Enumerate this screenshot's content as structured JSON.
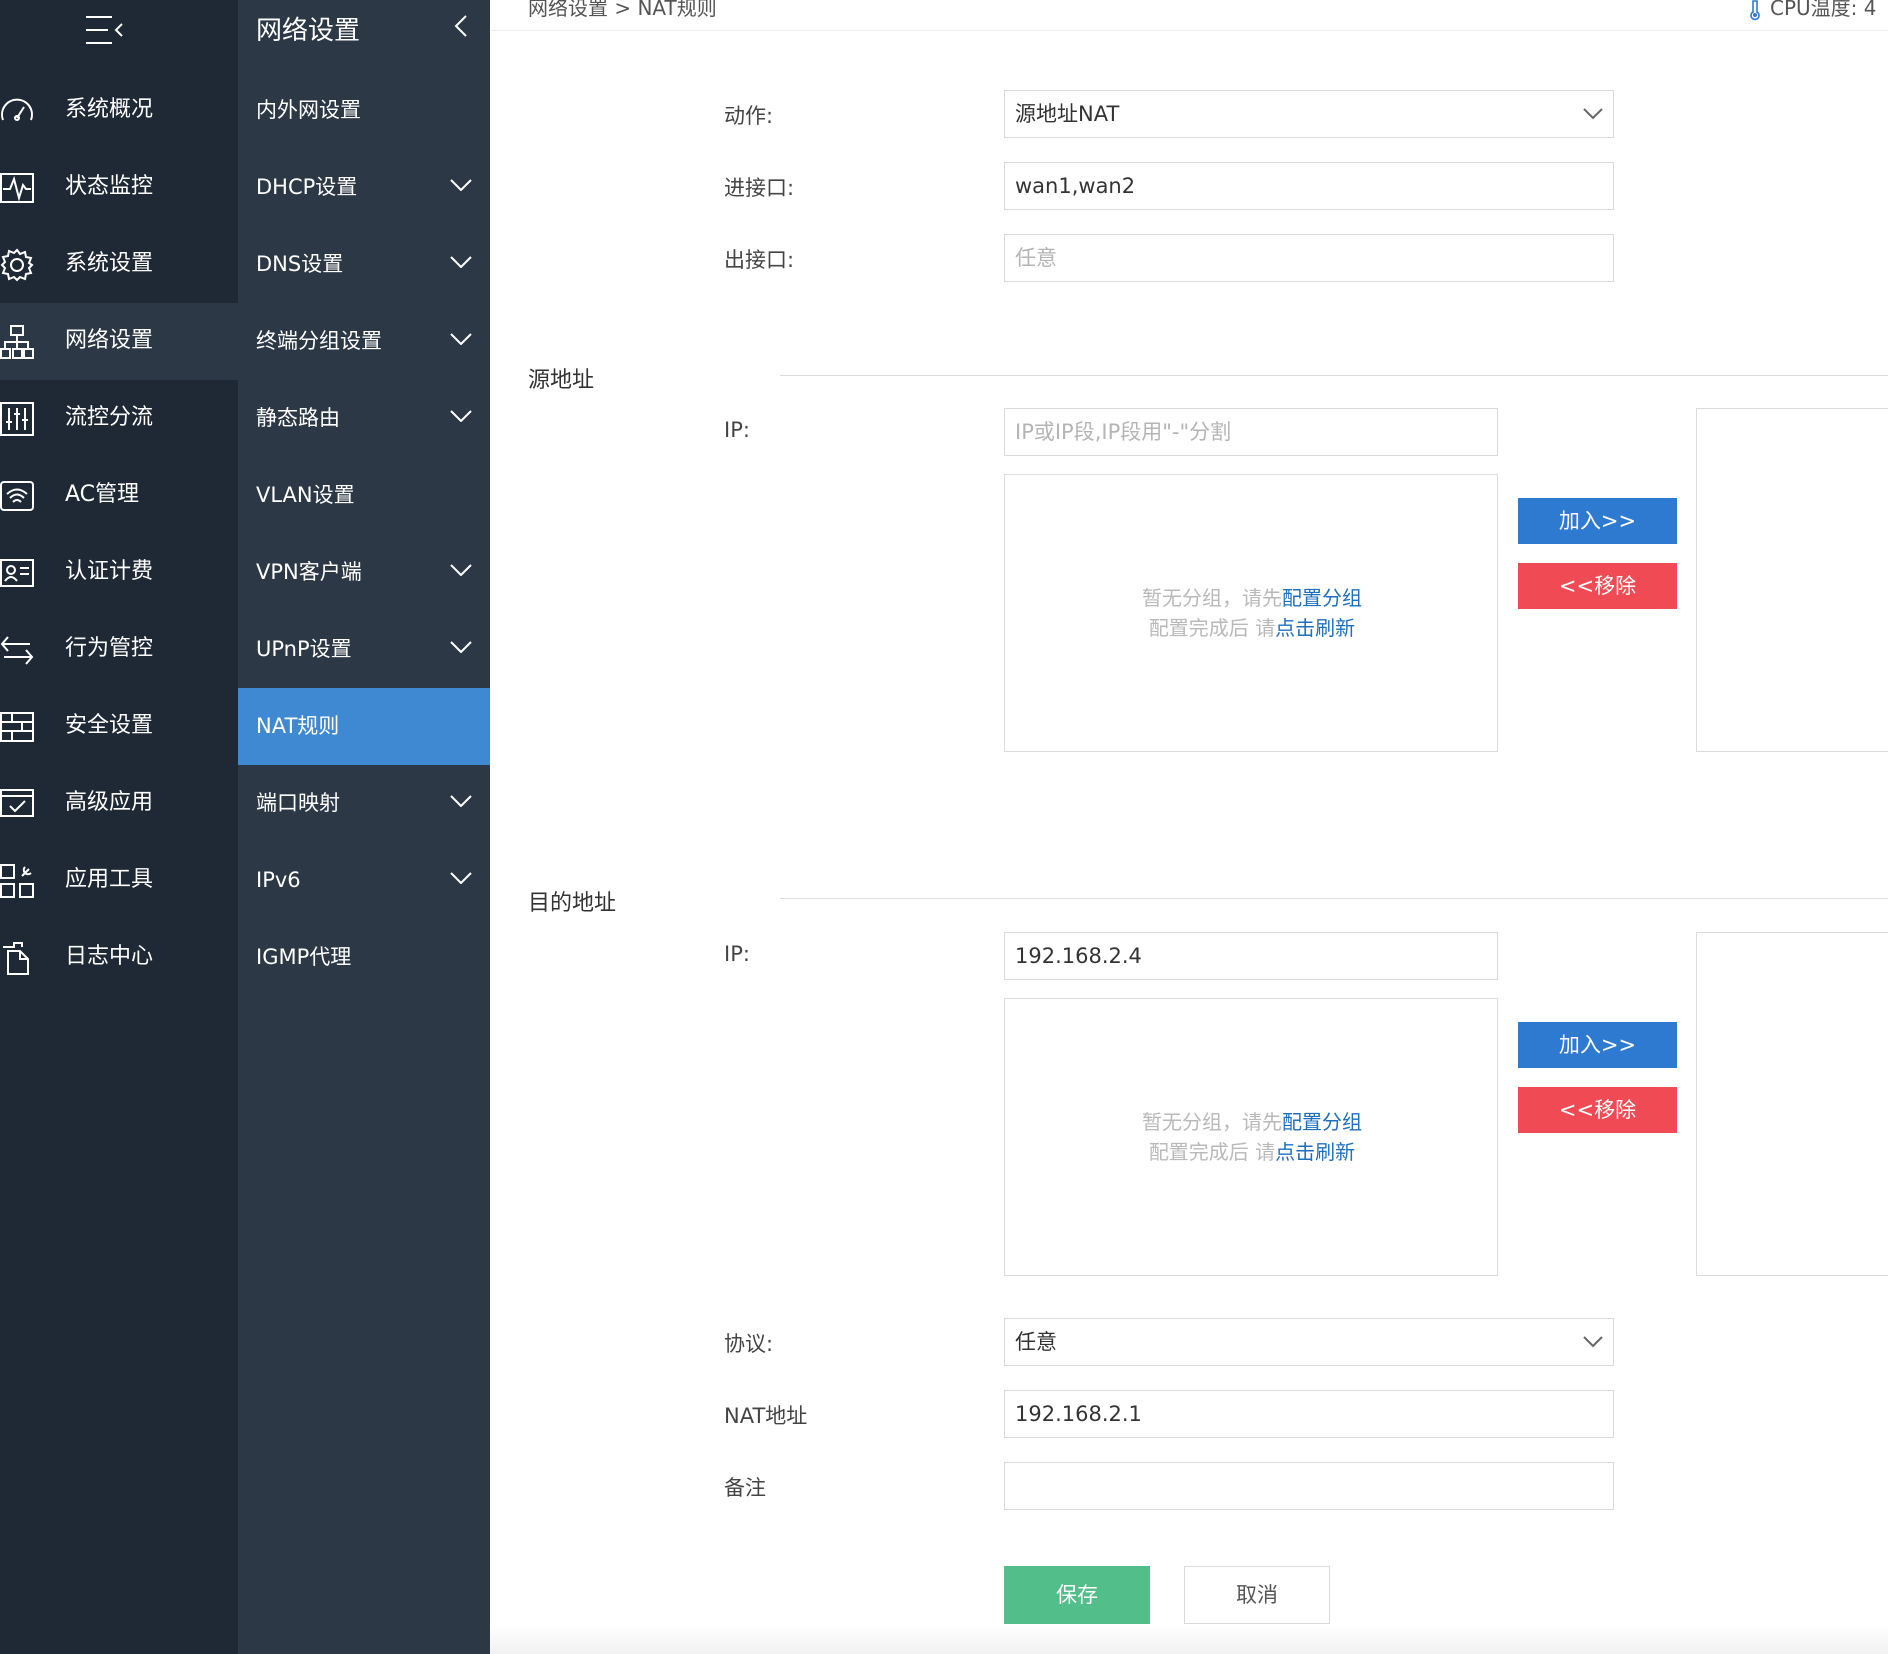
{
  "primary_nav": {
    "items": [
      {
        "label": "系统概况",
        "icon": "gauge-icon"
      },
      {
        "label": "状态监控",
        "icon": "pulse-icon"
      },
      {
        "label": "系统设置",
        "icon": "gear-icon"
      },
      {
        "label": "网络设置",
        "icon": "network-icon"
      },
      {
        "label": "流控分流",
        "icon": "sliders-icon"
      },
      {
        "label": "AC管理",
        "icon": "wifi-icon"
      },
      {
        "label": "认证计费",
        "icon": "id-card-icon"
      },
      {
        "label": "行为管控",
        "icon": "arrows-icon"
      },
      {
        "label": "安全设置",
        "icon": "firewall-icon"
      },
      {
        "label": "高级应用",
        "icon": "check-monitor-icon"
      },
      {
        "label": "应用工具",
        "icon": "tools-icon"
      },
      {
        "label": "日志中心",
        "icon": "document-icon"
      }
    ]
  },
  "secondary_nav": {
    "title": "网络设置",
    "items": [
      {
        "label": "内外网设置"
      },
      {
        "label": "DHCP设置"
      },
      {
        "label": "DNS设置"
      },
      {
        "label": "终端分组设置"
      },
      {
        "label": "静态路由"
      },
      {
        "label": "VLAN设置"
      },
      {
        "label": "VPN客户端"
      },
      {
        "label": "UPnP设置"
      },
      {
        "label": "NAT规则"
      },
      {
        "label": "端口映射"
      },
      {
        "label": "IPv6"
      },
      {
        "label": "IGMP代理"
      }
    ]
  },
  "header": {
    "breadcrumb": "网络设置 > NAT规则",
    "cpu_label": "CPU温度: 4"
  },
  "form": {
    "action_label": "动作:",
    "action_value": "源地址NAT",
    "in_iface_label": "进接口:",
    "in_iface_value": "wan1,wan2",
    "out_iface_label": "出接口:",
    "out_iface_placeholder": "任意",
    "src_section": "源地址",
    "src_ip_label": "IP:",
    "src_ip_placeholder": "IP或IP段,IP段用\"-\"分割",
    "dst_section": "目的地址",
    "dst_ip_label": "IP:",
    "dst_ip_value": "192.168.2.4",
    "protocol_label": "协议:",
    "protocol_value": "任意",
    "nat_addr_label": "NAT地址",
    "nat_addr_value": "192.168.2.1",
    "remark_label": "备注",
    "remark_value": ""
  },
  "group_msg": {
    "line1_prefix": "暂无分组，请先",
    "line1_link": "配置分组",
    "line2_prefix": "配置完成后 请",
    "line2_link": "点击刷新"
  },
  "buttons": {
    "add": "加入>>",
    "remove": "<<移除",
    "save": "保存",
    "cancel": "取消"
  }
}
